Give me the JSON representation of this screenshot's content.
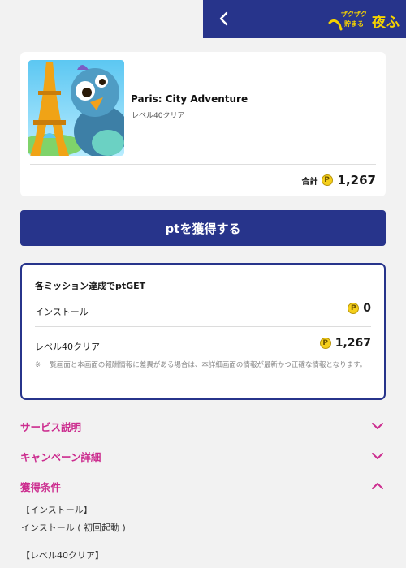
{
  "header": {
    "back_icon": "chevron-left-icon",
    "logo_text_small": "ザクザク 貯まる",
    "logo_text_large": "夜ふ"
  },
  "app": {
    "title": "Paris: City Adventure",
    "subtitle": "レベル40クリア",
    "total_label": "合計",
    "coin_glyph": "P",
    "total_points": "1,267"
  },
  "cta": {
    "label": "ptを獲得する"
  },
  "missions": {
    "heading": "各ミッション達成でptGET",
    "items": [
      {
        "name": "インストール",
        "points": "0"
      },
      {
        "name": "レベル40クリア",
        "points": "1,267"
      }
    ],
    "note": "※ 一覧画面と本画面の報酬情報に差異がある場合は、本詳細画面の情報が最新かつ正確な情報となります。"
  },
  "sections": [
    {
      "title": "サービス説明",
      "state": "collapsed"
    },
    {
      "title": "キャンペーン詳細",
      "state": "collapsed"
    },
    {
      "title": "獲得条件",
      "state": "expanded"
    }
  ],
  "conditions": [
    "【インストール】",
    "インストール ( 初回起動 )",
    "【レベル40クリア】"
  ],
  "colors": {
    "navy": "#27348b",
    "accent_pink": "#cc2d8f",
    "coin": "#f5cf1b",
    "background": "#f2f2f2"
  }
}
